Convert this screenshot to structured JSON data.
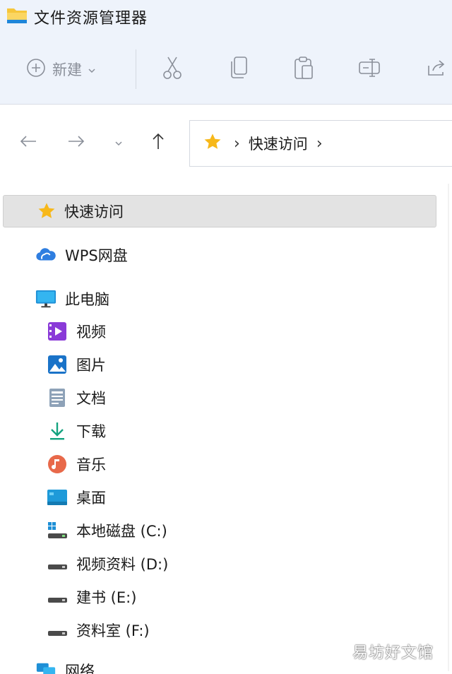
{
  "window": {
    "title": "文件资源管理器"
  },
  "toolbar": {
    "new_label": "新建",
    "actions": [
      "cut-icon",
      "copy-icon",
      "paste-icon",
      "rename-icon",
      "share-icon"
    ]
  },
  "address": {
    "path": [
      "快速访问"
    ]
  },
  "sidebar": {
    "quick_access": "快速访问",
    "wps_drive": "WPS网盘",
    "this_pc": "此电脑",
    "items": [
      {
        "label": "视频",
        "icon": "video-icon"
      },
      {
        "label": "图片",
        "icon": "pictures-icon"
      },
      {
        "label": "文档",
        "icon": "documents-icon"
      },
      {
        "label": "下载",
        "icon": "download-icon"
      },
      {
        "label": "音乐",
        "icon": "music-icon"
      },
      {
        "label": "桌面",
        "icon": "desktop-icon"
      },
      {
        "label": "本地磁盘 (C:)",
        "icon": "system-drive-icon"
      },
      {
        "label": "视频资料 (D:)",
        "icon": "drive-icon"
      },
      {
        "label": "建书 (E:)",
        "icon": "drive-icon"
      },
      {
        "label": "资料室 (F:)",
        "icon": "drive-icon"
      }
    ],
    "network": "网络"
  },
  "watermark": "易坊好文馆",
  "colors": {
    "toolbar_bg": "#eef3fb",
    "selected_bg": "#e3e3e3",
    "star": "#f7b81a",
    "accent_blue": "#1e8fd6"
  }
}
